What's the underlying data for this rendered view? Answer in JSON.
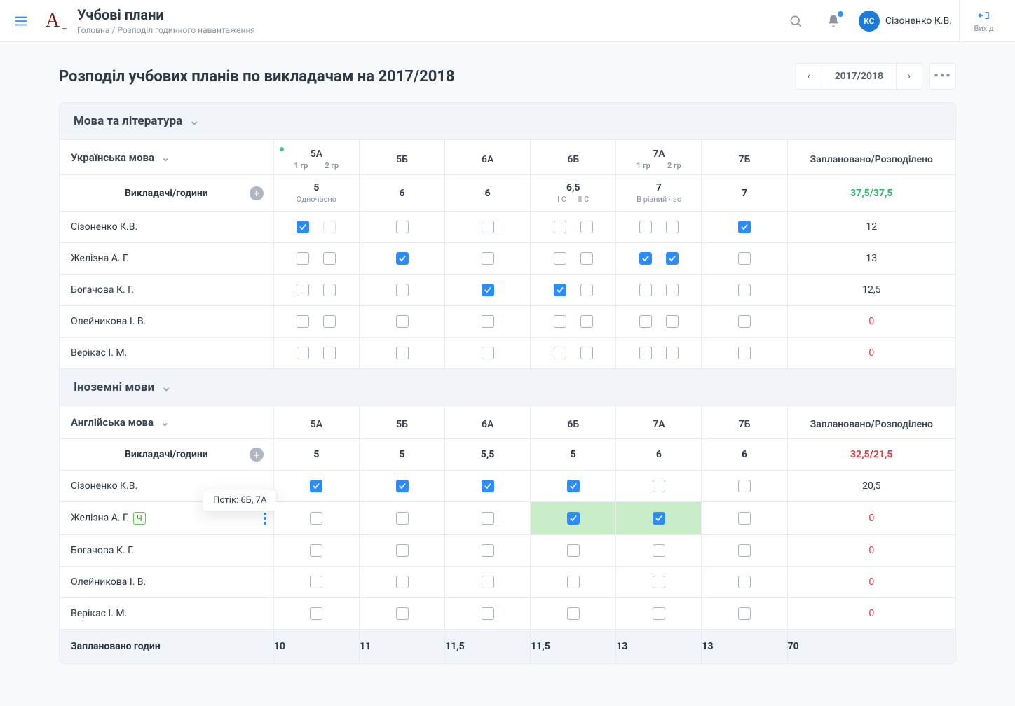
{
  "header": {
    "title": "Учбові плани",
    "crumb1": "Головна",
    "sep": " / ",
    "crumb2": "Розподіл годинного навантаження",
    "avatar": "КС",
    "username": "Сізоненко К.В.",
    "exit": "Вихід"
  },
  "page": {
    "title": "Розподіл учбових планів по викладачам на 2017/2018",
    "year": "2017/2018"
  },
  "icons": {
    "chev": "⌄",
    "plus": "+",
    "prev": "‹",
    "next": "›",
    "more": "•••"
  },
  "sec1": {
    "title": "Мова та література",
    "subject": "Українська мова",
    "plancol": "Заплановано/Розподілено",
    "classes": [
      "5А",
      "5Б",
      "6А",
      "6Б",
      "7А",
      "7Б"
    ],
    "grp": "1 гр",
    "grp2": "2 гр",
    "teachhdr": "Викладачі/години",
    "hours": [
      "5",
      "6",
      "6",
      "6,5",
      "7",
      "7"
    ],
    "subnote_5a": "Одночасно",
    "subnote_6b_l": "І С",
    "subnote_6b_r": "ІІ С",
    "subnote_7a": "В різний час",
    "planned": "37,5/37,5",
    "teachers": [
      {
        "name": "Сізоненко К.В.",
        "sum": "12",
        "sumcls": "",
        "c": [
          [
            true,
            null
          ],
          [
            false
          ],
          [
            false
          ],
          [
            false,
            false
          ],
          [
            false,
            false
          ],
          [
            true
          ]
        ]
      },
      {
        "name": "Желізна А. Г.",
        "sum": "13",
        "sumcls": "",
        "c": [
          [
            false,
            false
          ],
          [
            true
          ],
          [
            false
          ],
          [
            false,
            false
          ],
          [
            true,
            true
          ],
          [
            false
          ]
        ]
      },
      {
        "name": "Богачова К. Г.",
        "sum": "12,5",
        "sumcls": "",
        "c": [
          [
            false,
            false
          ],
          [
            false
          ],
          [
            true
          ],
          [
            true,
            false
          ],
          [
            false,
            false
          ],
          [
            false
          ]
        ]
      },
      {
        "name": "Олейникова І. В.",
        "sum": "0",
        "sumcls": "zero",
        "c": [
          [
            false,
            false
          ],
          [
            false
          ],
          [
            false
          ],
          [
            false,
            false
          ],
          [
            false,
            false
          ],
          [
            false
          ]
        ]
      },
      {
        "name": "Верікас І. М.",
        "sum": "0",
        "sumcls": "zero",
        "c": [
          [
            false,
            false
          ],
          [
            false
          ],
          [
            false
          ],
          [
            false,
            false
          ],
          [
            false,
            false
          ],
          [
            false
          ]
        ]
      }
    ]
  },
  "sec2": {
    "title": "Іноземні мови",
    "subject": "Англійська мова",
    "plancol": "Заплановано/Розподілено",
    "classes": [
      "5А",
      "5Б",
      "6А",
      "6Б",
      "7А",
      "7Б"
    ],
    "teachhdr": "Викладачі/години",
    "hours": [
      "5",
      "5",
      "5,5",
      "5",
      "6",
      "6"
    ],
    "planned": "32,5/21,5",
    "tooltip": "Потік: 6Б, 7А",
    "tag": "Ч",
    "teachers": [
      {
        "name": "Сізоненко К.В.",
        "sum": "20,5",
        "c": [
          true,
          true,
          true,
          true,
          false,
          false
        ]
      },
      {
        "name": "Желізна А. Г.",
        "sum": "0",
        "sumcls": "zero",
        "tag": true,
        "more": true,
        "hl": [
          3,
          4
        ],
        "c": [
          false,
          false,
          false,
          true,
          true,
          false
        ]
      },
      {
        "name": "Богачова К. Г.",
        "sum": "0",
        "sumcls": "zero",
        "c": [
          false,
          false,
          false,
          false,
          false,
          false
        ]
      },
      {
        "name": "Олейникова І. В.",
        "sum": "0",
        "sumcls": "zero",
        "c": [
          false,
          false,
          false,
          false,
          false,
          false
        ]
      },
      {
        "name": "Верікас І. М.",
        "sum": "0",
        "sumcls": "zero",
        "c": [
          false,
          false,
          false,
          false,
          false,
          false
        ]
      }
    ],
    "footlabel": "Заплановано годин",
    "foothours": [
      "10",
      "11",
      "11,5",
      "11,5",
      "13",
      "13"
    ],
    "foottotal": "70"
  }
}
